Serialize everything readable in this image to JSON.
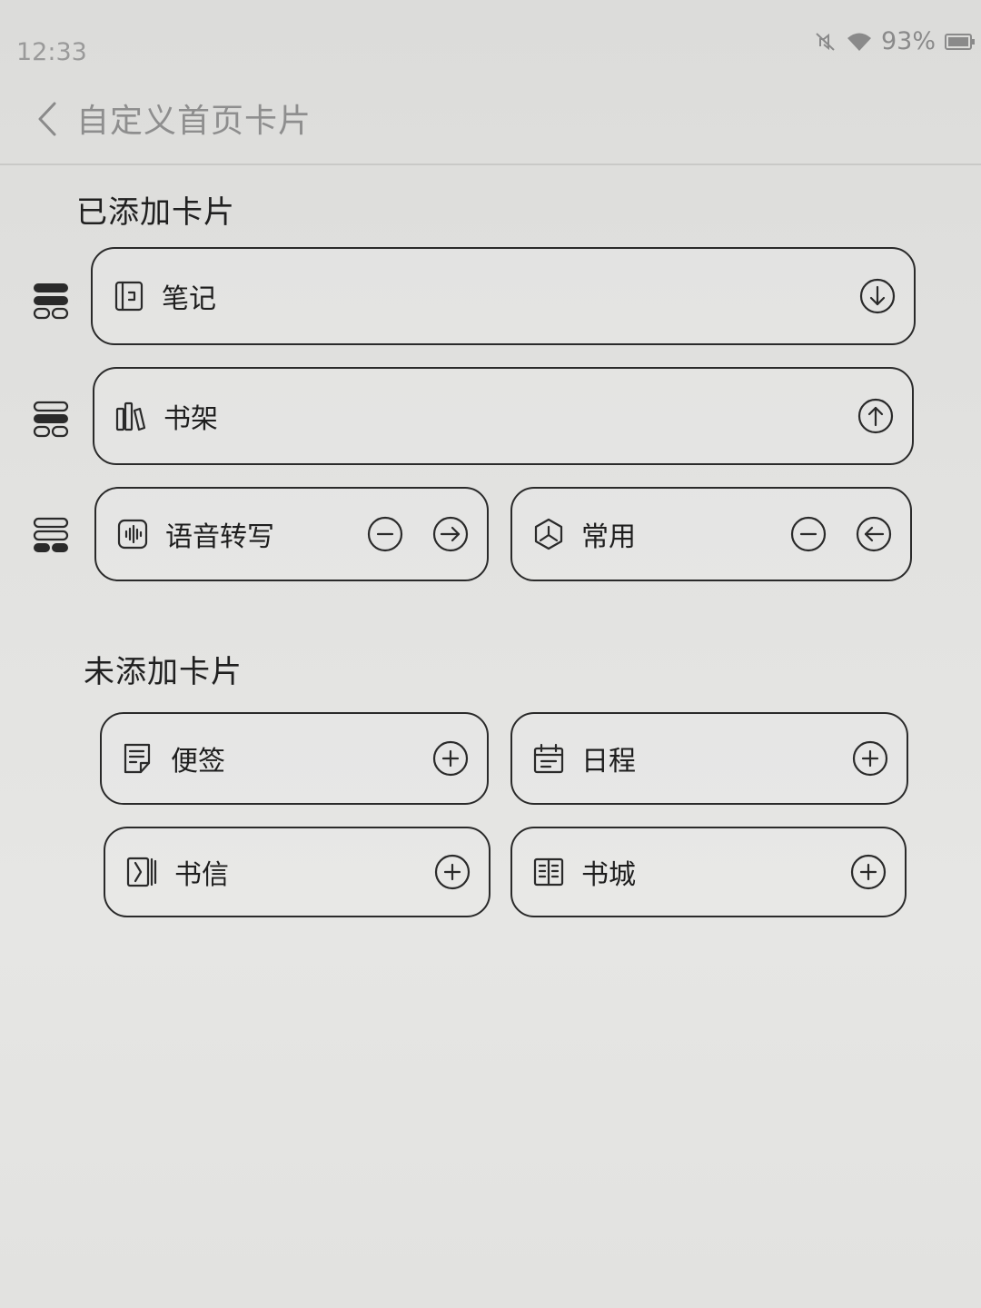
{
  "status": {
    "time": "12:33",
    "battery": "93%",
    "icons": [
      "mute-icon",
      "wifi-icon",
      "battery-icon"
    ]
  },
  "header": {
    "title": "自定义首页卡片",
    "back_icon": "chevron-left-icon"
  },
  "added": {
    "title": "已添加卡片",
    "cards": [
      {
        "label": "笔记",
        "icon": "notebook-icon",
        "actions": [
          "arrow-down-circle-icon"
        ]
      },
      {
        "label": "书架",
        "icon": "bookshelf-icon",
        "actions": [
          "arrow-up-circle-icon"
        ]
      },
      {
        "label": "语音转写",
        "icon": "voice-wave-icon",
        "actions": [
          "minus-circle-icon",
          "arrow-right-circle-icon"
        ]
      },
      {
        "label": "常用",
        "icon": "hexagon-icon",
        "actions": [
          "minus-circle-icon",
          "arrow-left-circle-icon"
        ]
      }
    ]
  },
  "not_added": {
    "title": "未添加卡片",
    "cards": [
      {
        "label": "便签",
        "icon": "sticky-note-icon",
        "actions": [
          "plus-circle-icon"
        ]
      },
      {
        "label": "日程",
        "icon": "calendar-icon",
        "actions": [
          "plus-circle-icon"
        ]
      },
      {
        "label": "书信",
        "icon": "letter-icon",
        "actions": [
          "plus-circle-icon"
        ]
      },
      {
        "label": "书城",
        "icon": "open-book-icon",
        "actions": [
          "plus-circle-icon"
        ]
      }
    ]
  }
}
